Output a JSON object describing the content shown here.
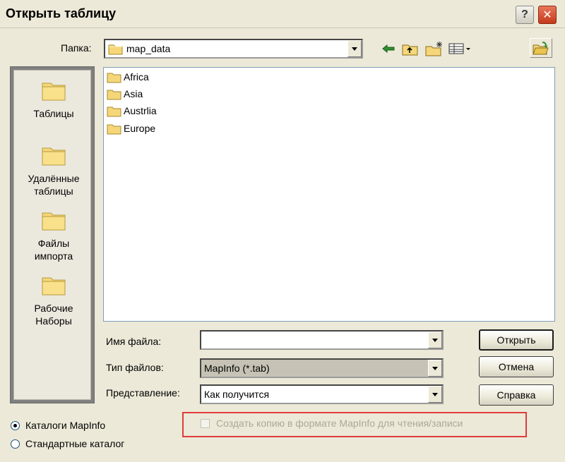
{
  "window": {
    "title": "Открыть таблицу",
    "help_glyph": "?",
    "close_glyph": "✕"
  },
  "toolbar": {
    "folder_label": "Папка:",
    "folder_value": "map_data"
  },
  "places": [
    {
      "label_line1": "Таблицы",
      "label_line2": ""
    },
    {
      "label_line1": "Удалённые",
      "label_line2": "таблицы"
    },
    {
      "label_line1": "Файлы",
      "label_line2": "импорта"
    },
    {
      "label_line1": "Рабочие",
      "label_line2": "Наборы"
    }
  ],
  "files": [
    "Africa",
    "Asia",
    "Austrlia",
    "Europe"
  ],
  "fields": {
    "filename_label": "Имя файла:",
    "filename_value": "",
    "filetype_label": "Тип файлов:",
    "filetype_value": "MapInfo (*.tab)",
    "view_label": "Представление:",
    "view_value": "Как получится"
  },
  "buttons": {
    "open": "Открыть",
    "cancel": "Отмена",
    "help": "Справка"
  },
  "catalog_options": {
    "mapinfo": "Каталоги MapInfo",
    "standard": "Стандартные каталог",
    "selected": "mapinfo"
  },
  "copy_option": {
    "label": "Создать копию в формате MapInfo для чтения/записи",
    "checked": false,
    "enabled": false
  },
  "colors": {
    "highlight_border": "#e03b3b",
    "folder_yellow": "#f5d77a",
    "dialog_bg": "#ece9d8"
  }
}
